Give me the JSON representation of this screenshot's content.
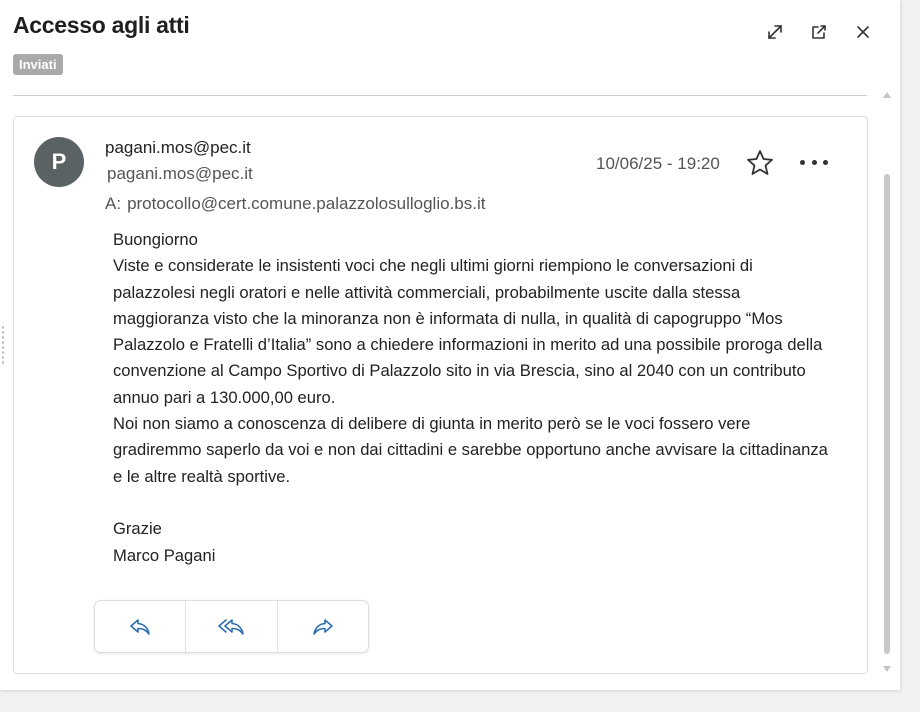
{
  "header": {
    "title": "Accesso agli atti",
    "badge": "Inviati",
    "icons": [
      "expand-icon",
      "open-external-icon",
      "close-icon"
    ]
  },
  "message": {
    "avatar_initial": "P",
    "from_address": "pagani.mos@pec.it",
    "from_name": "pagani.mos@pec.it",
    "to_label": "A:",
    "to_address": "protocollo@cert.comune.palazzolosulloglio.bs.it",
    "date": "10/06/25 - 19:20",
    "body": {
      "greeting": "Buongiorno",
      "paragraph1": "Viste e considerate le insistenti voci che negli ultimi giorni riempiono le conversazioni di palazzolesi negli oratori e nelle attività commerciali, probabilmente uscite dalla stessa maggioranza visto che la minoranza non è informata di nulla, in qualità di capogruppo “Mos Palazzolo e Fratelli d’Italia” sono a chiedere informazioni in merito ad una possibile proroga della convenzione al Campo Sportivo di Palazzolo sito in via Brescia, sino al 2040 con un contributo annuo pari a 130.000,00 euro.",
      "paragraph2": "Noi non siamo a conoscenza di delibere di giunta in merito però se le voci fossero vere gradiremmo saperlo da voi e non dai cittadini e sarebbe opportuno anche avvisare la cittadinanza e le altre realtà sportive.",
      "closing": "Grazie",
      "signature": "Marco Pagani"
    },
    "actions": [
      "reply-icon",
      "reply-all-icon",
      "forward-icon"
    ]
  },
  "colors": {
    "avatar_bg": "#5a6263",
    "badge_bg": "#a9a9a9",
    "action_icon": "#2f6fb0"
  }
}
